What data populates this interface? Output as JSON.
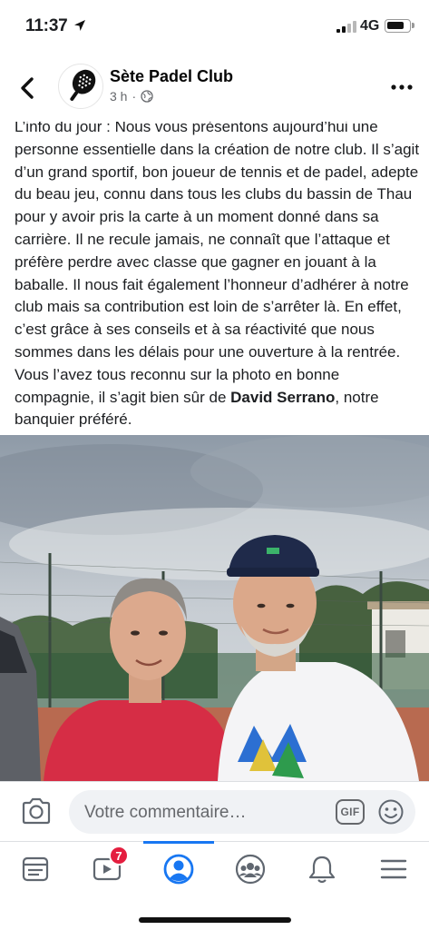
{
  "status_bar": {
    "time": "11:37",
    "network": "4G",
    "signal_level": 2,
    "battery_level": 0.8
  },
  "header": {
    "club_name": "Sète Padel Club",
    "post_age": "3 h",
    "separator": "·",
    "back_icon": "chevron-left-icon",
    "more_icon": "more-dots-icon",
    "audience_icon": "globe-icon"
  },
  "post": {
    "text_before_name": "L’info du jour : Nous vous présentons aujourd’hui une personne essentielle dans la création de notre club. Il s’agit d’un grand sportif, bon joueur de tennis et de padel, adepte du beau jeu, connu dans tous les clubs du bassin de Thau pour y avoir pris la carte à un moment donné dans sa carrière. Il ne recule jamais, ne connaît que l’attaque et préfère perdre avec classe que gagner en jouant à la baballe. Il nous fait également l’honneur d’adhérer à notre club mais sa contribution est loin de s’arrêter là. En effet, c’est grâce à ses conseils et à sa réactivité que nous sommes dans les délais pour une ouverture à la rentrée. Vous l’avez tous reconnu sur la photo en bonne compagnie, il s’agit bien sûr de ",
    "bold_name": "David Serrano",
    "text_after_name": ", notre banquier préféré."
  },
  "comment_bar": {
    "placeholder": "Votre commentaire…",
    "gif_label": "GIF",
    "camera_icon": "camera-icon",
    "emoji_icon": "emoji-icon"
  },
  "tab_bar": {
    "tabs": [
      {
        "name": "feed",
        "icon": "news-feed-icon",
        "active": false
      },
      {
        "name": "watch",
        "icon": "video-icon",
        "active": false,
        "badge": "7"
      },
      {
        "name": "profile",
        "icon": "profile-icon",
        "active": true
      },
      {
        "name": "groups",
        "icon": "groups-icon",
        "active": false
      },
      {
        "name": "notifications",
        "icon": "bell-icon",
        "active": false
      },
      {
        "name": "menu",
        "icon": "menu-icon",
        "active": false
      }
    ]
  },
  "colors": {
    "accent": "#1877f2",
    "badge": "#e41e3f",
    "secondary_text": "#65676b",
    "icon_gray": "#606770"
  }
}
